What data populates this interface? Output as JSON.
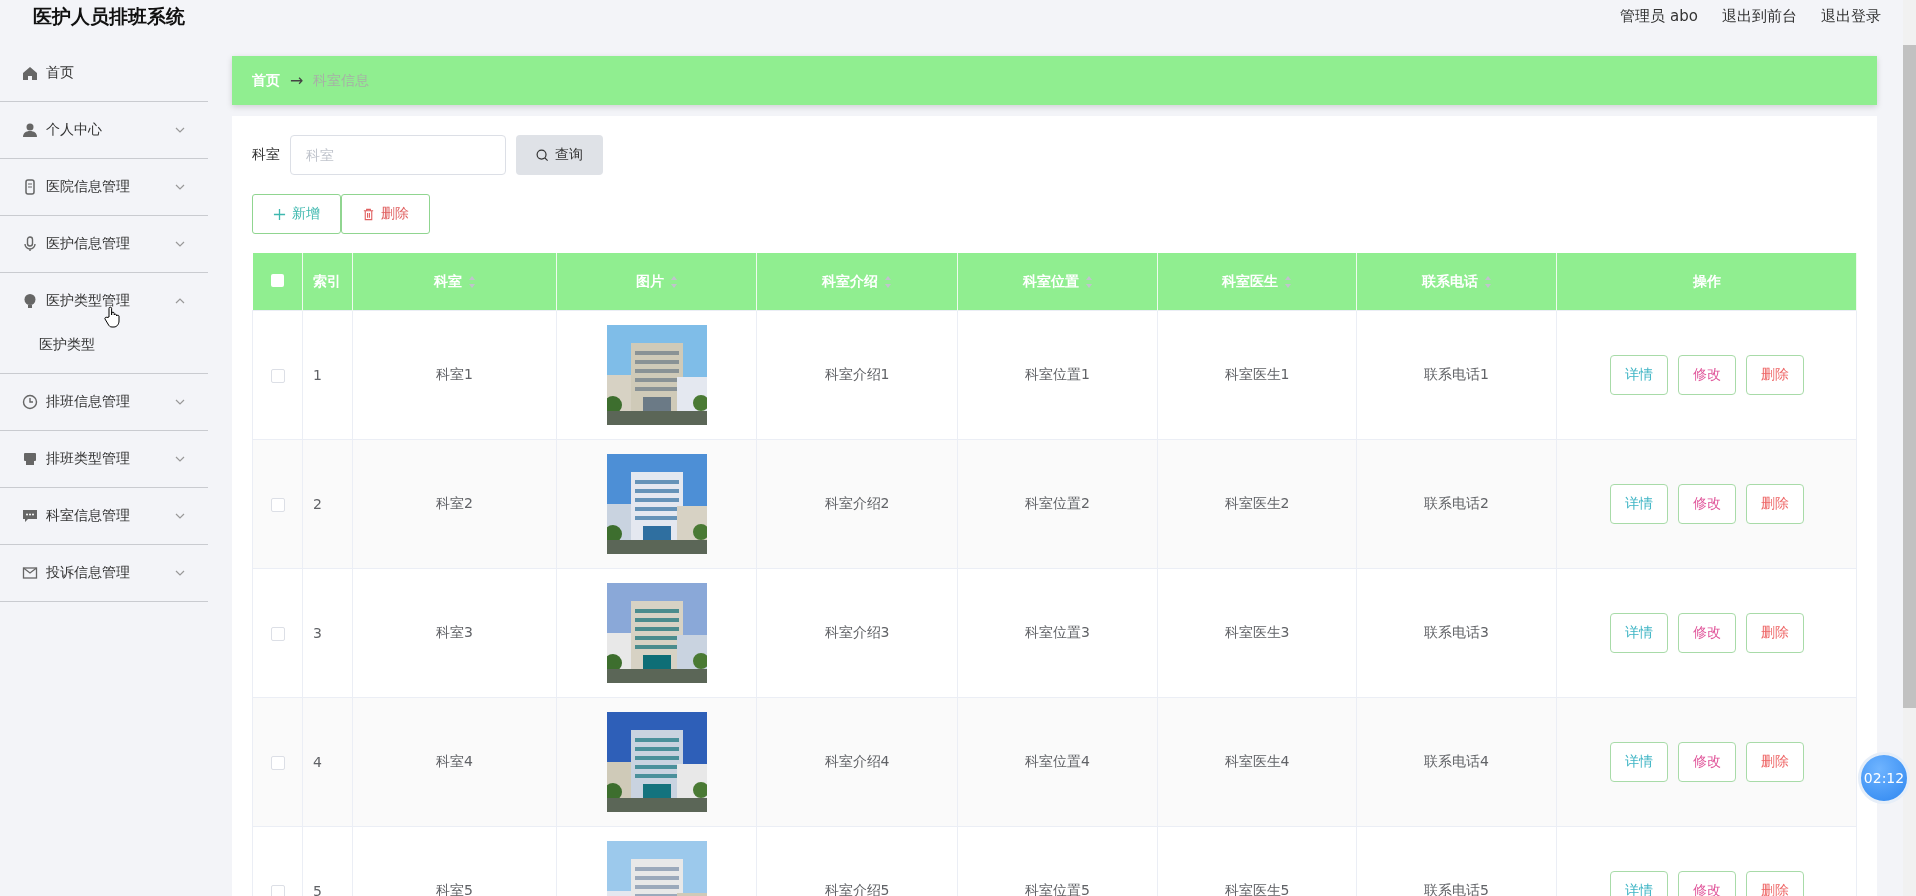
{
  "header": {
    "title": "医护人员排班系统",
    "user": "管理员 abo",
    "links": [
      "退出到前台",
      "退出登录"
    ]
  },
  "sidebar": {
    "items": [
      {
        "label": "首页",
        "kind": "link"
      },
      {
        "label": "个人中心",
        "kind": "menu",
        "expanded": false
      },
      {
        "label": "医院信息管理",
        "kind": "menu",
        "expanded": false
      },
      {
        "label": "医护信息管理",
        "kind": "menu",
        "expanded": false
      },
      {
        "label": "医护类型管理",
        "kind": "menu",
        "expanded": true,
        "children": [
          {
            "label": "医护类型"
          }
        ]
      },
      {
        "label": "排班信息管理",
        "kind": "menu",
        "expanded": false
      },
      {
        "label": "排班类型管理",
        "kind": "menu",
        "expanded": false
      },
      {
        "label": "科室信息管理",
        "kind": "menu",
        "expanded": false
      },
      {
        "label": "投诉信息管理",
        "kind": "menu",
        "expanded": false
      }
    ]
  },
  "breadcrumb": {
    "items": [
      "首页",
      "科室信息"
    ],
    "separator": "→"
  },
  "search": {
    "label": "科室",
    "placeholder": "科室",
    "button": "查询"
  },
  "actions": [
    {
      "label": "新增",
      "kind": "add"
    },
    {
      "label": "删除",
      "kind": "delete"
    }
  ],
  "table": {
    "select_all": {
      "checked": false
    },
    "columns": [
      {
        "label": "索引",
        "sortable": false
      },
      {
        "label": "科室",
        "sortable": true
      },
      {
        "label": "图片",
        "sortable": true
      },
      {
        "label": "科室介绍",
        "sortable": true
      },
      {
        "label": "科室位置",
        "sortable": true
      },
      {
        "label": "科室医生",
        "sortable": true
      },
      {
        "label": "联系电话",
        "sortable": true
      },
      {
        "label": "操作",
        "sortable": false
      }
    ],
    "rows": [
      {
        "checked": false,
        "cells": [
          "1",
          "科室1",
          {
            "kind": "picture"
          },
          "科室介绍1",
          "科室位置1",
          "科室医生1",
          "联系电话1"
        ],
        "actions": [
          {
            "label": "详情",
            "kind": "detail"
          },
          {
            "label": "修改",
            "kind": "edit"
          },
          {
            "label": "删除",
            "kind": "delete"
          }
        ]
      },
      {
        "checked": false,
        "cells": [
          "2",
          "科室2",
          {
            "kind": "picture"
          },
          "科室介绍2",
          "科室位置2",
          "科室医生2",
          "联系电话2"
        ],
        "actions": [
          {
            "label": "详情",
            "kind": "detail"
          },
          {
            "label": "修改",
            "kind": "edit"
          },
          {
            "label": "删除",
            "kind": "delete"
          }
        ]
      },
      {
        "checked": false,
        "cells": [
          "3",
          "科室3",
          {
            "kind": "picture"
          },
          "科室介绍3",
          "科室位置3",
          "科室医生3",
          "联系电话3"
        ],
        "actions": [
          {
            "label": "详情",
            "kind": "detail"
          },
          {
            "label": "修改",
            "kind": "edit"
          },
          {
            "label": "删除",
            "kind": "delete"
          }
        ]
      },
      {
        "checked": false,
        "cells": [
          "4",
          "科室4",
          {
            "kind": "picture"
          },
          "科室介绍4",
          "科室位置4",
          "科室医生4",
          "联系电话4"
        ],
        "actions": [
          {
            "label": "详情",
            "kind": "detail"
          },
          {
            "label": "修改",
            "kind": "edit"
          },
          {
            "label": "删除",
            "kind": "delete"
          }
        ]
      },
      {
        "checked": false,
        "cells": [
          "5",
          "科室5",
          {
            "kind": "picture"
          },
          "科室介绍5",
          "科室位置5",
          "科室医生5",
          "联系电话5"
        ],
        "actions": [
          {
            "label": "详情",
            "kind": "detail"
          },
          {
            "label": "修改",
            "kind": "edit"
          },
          {
            "label": "删除",
            "kind": "delete"
          }
        ]
      }
    ]
  },
  "timer": "02:12"
}
